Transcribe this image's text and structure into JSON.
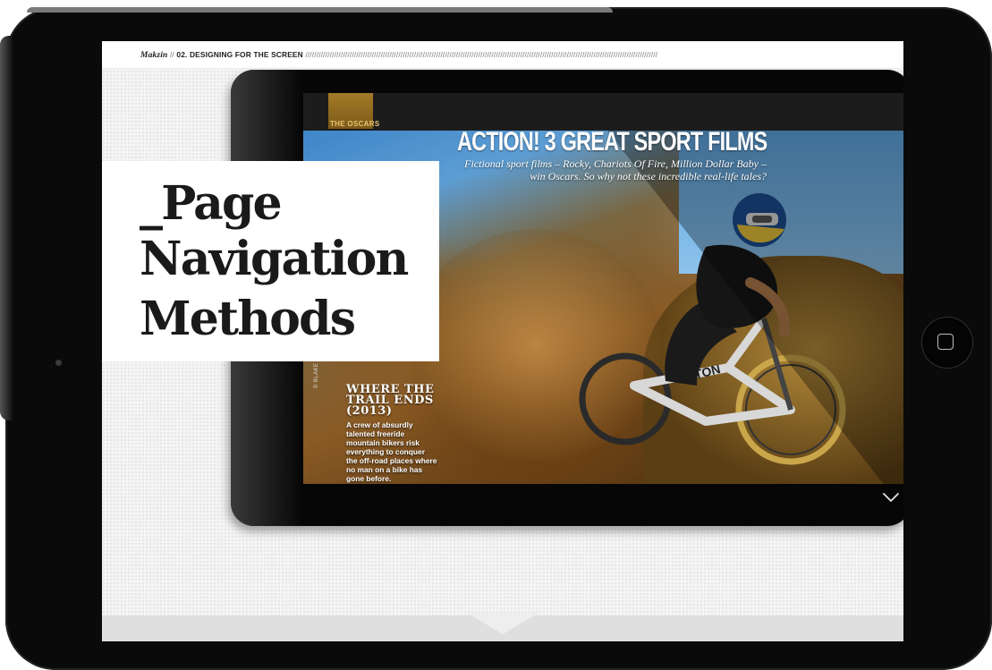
{
  "header": {
    "brand": "Makzin",
    "separator": " // ",
    "section": "02. DESIGNING FOR THE SCREEN",
    "rule": " ///////////////////////////////////////////////////////////////////////////////////////////////////////////////////////////////////////////////////////////////"
  },
  "title_card": {
    "line1": "_Page",
    "line2": "Navigation",
    "line3": "Methods"
  },
  "article": {
    "tab_label": "THE OSCARS",
    "headline": "ACTION! 3 GREAT SPORT FILMS",
    "subhead": "Fictional sport films – Rocky, Chariots Of Fire, Million Dollar Baby – win Oscars. So why not these incredible real-life tales?",
    "photo_credit": "© BLAKE JORGENSON/RED BULL CONTENT POOL",
    "sidebar_title_line1": "WHERE THE",
    "sidebar_title_line2": "TRAIL ENDS",
    "sidebar_title_line3": "(2013)",
    "sidebar_body": "A crew of absurdly talented freeride mountain bikers risk everything to conquer the off-road places where no man on a bike has gone before.",
    "bike_brand": "NOTON"
  },
  "icons": {
    "next_page": "chevron-down-icon",
    "home": "home-button-icon"
  },
  "colors": {
    "bezel": "#0a0a0a",
    "screen_bg": "#f4f4f4",
    "accent_gold": "#b88a2c",
    "bottom_bar": "#dfdfdf"
  }
}
